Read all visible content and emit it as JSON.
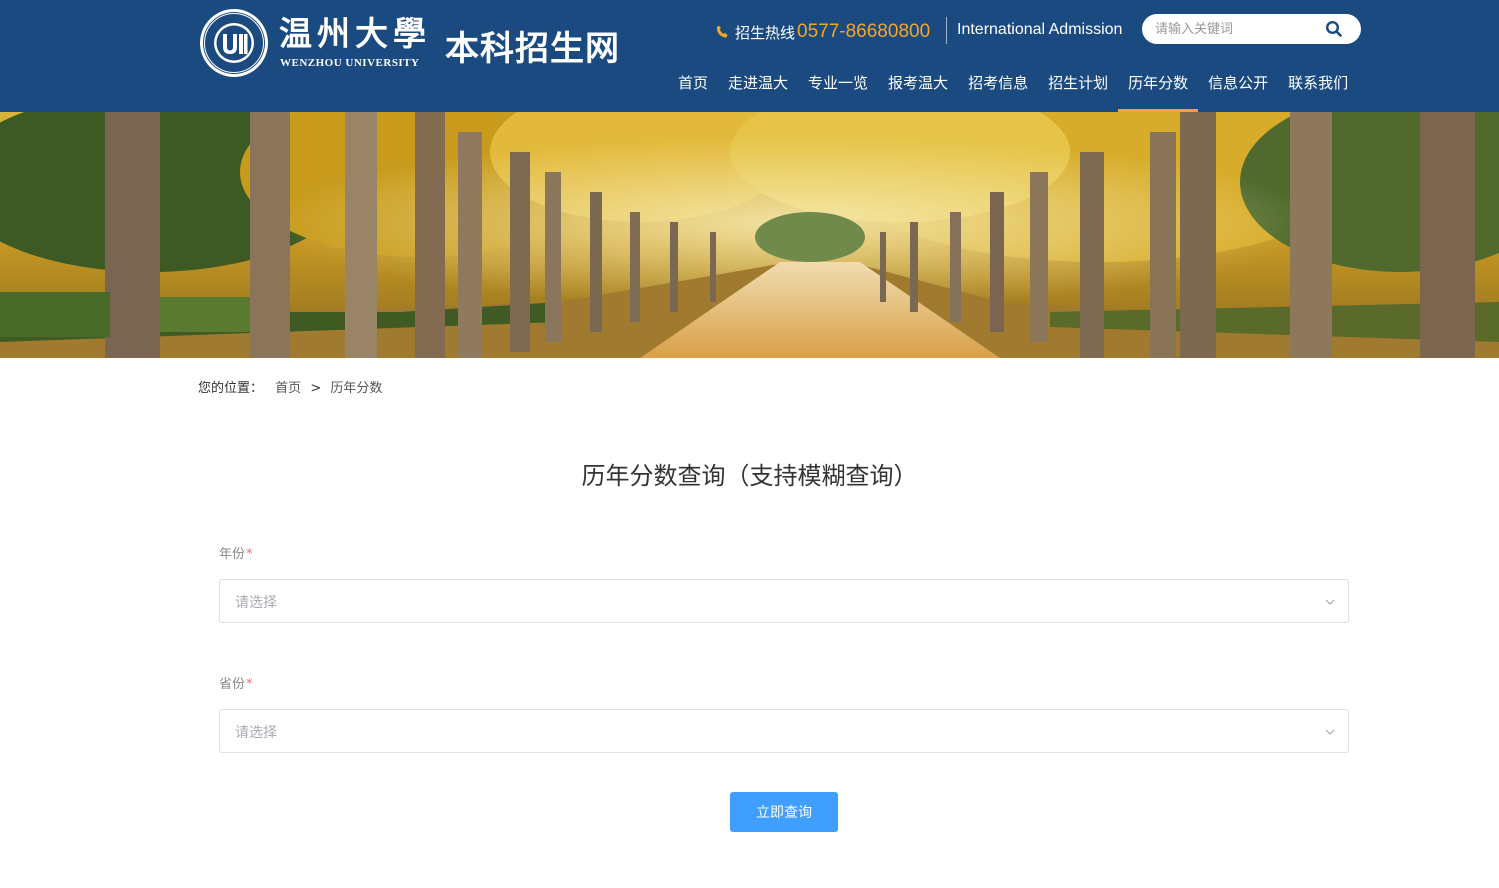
{
  "header": {
    "logo_seal_text": "WENZHOU UNIVERSITY",
    "logo_cn": "温州大學",
    "logo_en": "WENZHOU UNIVERSITY",
    "site_name": "本科招生网",
    "hotline_label": "招生热线",
    "hotline_number": "0577-86680800",
    "intl_link": "International Admission",
    "search_placeholder": "请输入关键词",
    "nav": [
      {
        "label": "首页"
      },
      {
        "label": "走进温大"
      },
      {
        "label": "专业一览"
      },
      {
        "label": "报考温大"
      },
      {
        "label": "招考信息"
      },
      {
        "label": "招生计划"
      },
      {
        "label": "历年分数"
      },
      {
        "label": "信息公开"
      },
      {
        "label": "联系我们"
      }
    ],
    "active_nav": "历年分数"
  },
  "breadcrumb": {
    "label": "您的位置：",
    "home": "首页",
    "separator": ">",
    "current": "历年分数"
  },
  "form": {
    "title": "历年分数查询（支持模糊查询）",
    "year": {
      "label": "年份",
      "required_mark": "*",
      "placeholder": "请选择"
    },
    "province": {
      "label": "省份",
      "required_mark": "*",
      "placeholder": "请选择"
    },
    "submit_label": "立即查询"
  },
  "colors": {
    "header_bg": "#1a4a80",
    "accent": "#f5a623",
    "button": "#409eff",
    "required": "#f56c6c"
  }
}
